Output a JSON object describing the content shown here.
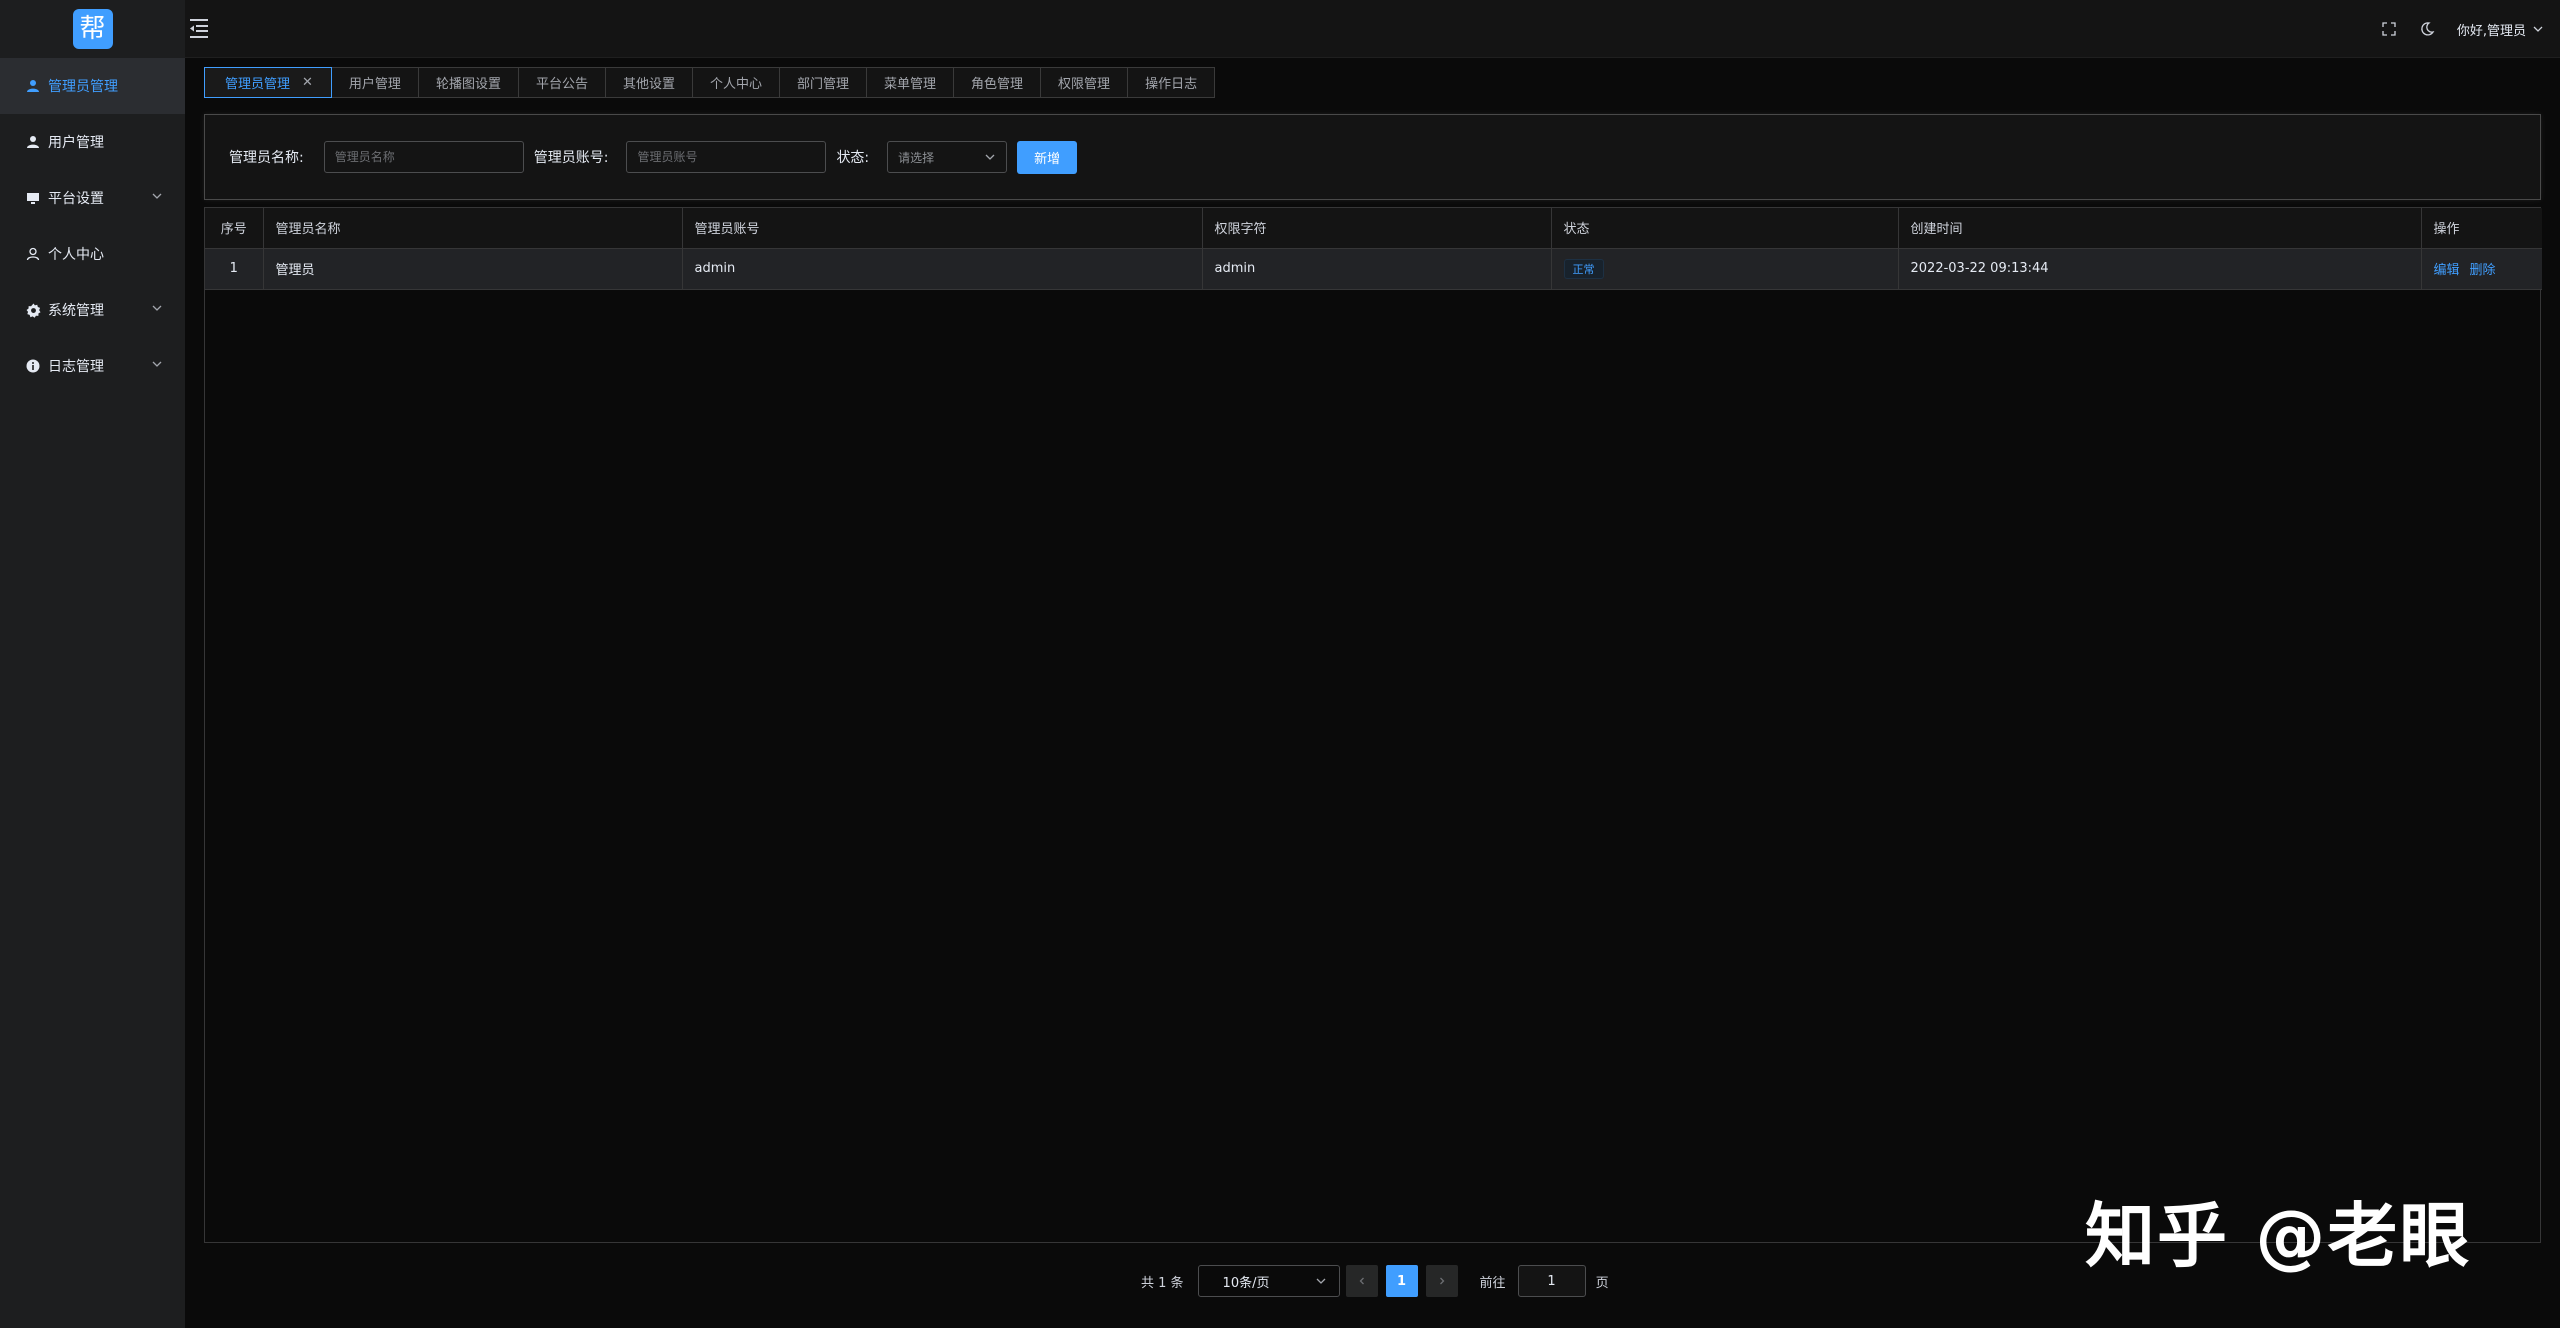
{
  "app": {
    "logo_char": "帮"
  },
  "sidebar": {
    "items": [
      {
        "label": "管理员管理",
        "active": true,
        "icon": "user-filled-icon",
        "expandable": false
      },
      {
        "label": "用户管理",
        "active": false,
        "icon": "user-filled-icon",
        "expandable": false
      },
      {
        "label": "平台设置",
        "active": false,
        "icon": "monitor-icon",
        "expandable": true
      },
      {
        "label": "个人中心",
        "active": false,
        "icon": "user-outline-icon",
        "expandable": false
      },
      {
        "label": "系统管理",
        "active": false,
        "icon": "gear-icon",
        "expandable": true
      },
      {
        "label": "日志管理",
        "active": false,
        "icon": "info-icon",
        "expandable": true
      }
    ]
  },
  "topbar": {
    "greeting": "你好,管理员"
  },
  "tabs": [
    {
      "label": "管理员管理",
      "active": true
    },
    {
      "label": "用户管理"
    },
    {
      "label": "轮播图设置"
    },
    {
      "label": "平台公告"
    },
    {
      "label": "其他设置"
    },
    {
      "label": "个人中心"
    },
    {
      "label": "部门管理"
    },
    {
      "label": "菜单管理"
    },
    {
      "label": "角色管理"
    },
    {
      "label": "权限管理"
    },
    {
      "label": "操作日志"
    }
  ],
  "search": {
    "name_label": "管理员名称:",
    "name_placeholder": "管理员名称",
    "account_label": "管理员账号:",
    "account_placeholder": "管理员账号",
    "status_label": "状态:",
    "status_placeholder": "请选择",
    "add_button": "新增"
  },
  "table": {
    "columns": [
      "序号",
      "管理员名称",
      "管理员账号",
      "权限字符",
      "状态",
      "创建时间",
      "操作"
    ],
    "rows": [
      {
        "index": "1",
        "name": "管理员",
        "account": "admin",
        "perm": "admin",
        "status": "正常",
        "created": "2022-03-22 09:13:44",
        "edit": "编辑",
        "delete": "删除"
      }
    ]
  },
  "pagination": {
    "total": "共 1 条",
    "page_size": "10条/页",
    "current_page": "1",
    "goto_label": "前往",
    "goto_value": "1",
    "page_suffix": "页"
  },
  "watermark": "知乎 @老眼",
  "colors": {
    "accent": "#409eff",
    "sidebar_bg": "#1d1e1f",
    "page_bg": "#0a0a0a"
  }
}
